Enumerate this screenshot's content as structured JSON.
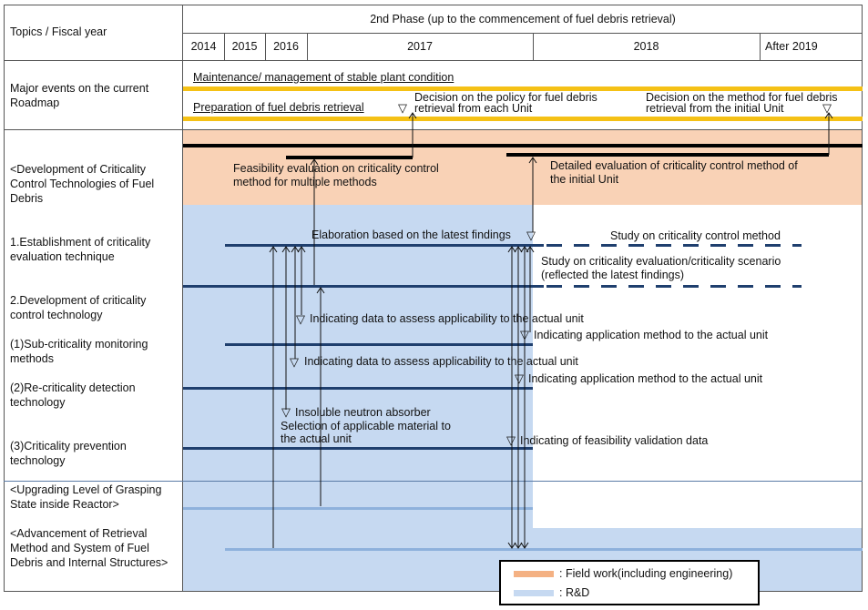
{
  "header": {
    "topics_label": "Topics / Fiscal year",
    "phase_label": "2nd Phase (up to the commencement of fuel debris retrieval)",
    "years": [
      "2014",
      "2015",
      "2016",
      "2017",
      "2018",
      "After 2019"
    ]
  },
  "rows": {
    "major_events": "Major events on the current Roadmap",
    "development": "<Development of Criticality Control Technologies of Fuel Debris",
    "item1": "1.Establishment of criticality evaluation technique",
    "item2": "2.Development of criticality control technology",
    "sub1": "(1)Sub-criticality monitoring methods",
    "sub2": "(2)Re-criticality detection technology",
    "sub3": "(3)Criticality prevention technology",
    "grasping": "<Upgrading Level of Grasping State inside Reactor>",
    "retrieval": "<Advancement of Retrieval Method and System of Fuel Debris and Internal Structures>"
  },
  "events": {
    "maintenance": "Maintenance/ management of stable plant condition",
    "preparation": "Preparation of fuel debris retrieval",
    "decision_policy_1": "Decision on the policy for fuel debris",
    "decision_policy_2": "retrieval from each Unit",
    "decision_method_1": "Decision on the method for fuel debris",
    "decision_method_2": "retrieval from the initial Unit"
  },
  "annotations": {
    "feasibility_1": "Feasibility evaluation on criticality control",
    "feasibility_2": "method for multiple methods",
    "detailed_1": "Detailed evaluation of criticality control method of",
    "detailed_2": "the initial Unit",
    "elaboration": "Elaboration based on the latest findings",
    "study_control": "Study on criticality control method",
    "study_eval_1": "Study on criticality evaluation/criticality scenario",
    "study_eval_2": "(reflected the latest findings)",
    "data_assess_1": "Indicating data to assess applicability to the actual unit",
    "app_method_1": "Indicating application method to the actual unit",
    "data_assess_2": "Indicating data to assess applicability to the actual unit",
    "app_method_2": "Indicating application method to the actual unit",
    "absorber_1": "Insoluble neutron absorber",
    "absorber_2": "Selection of applicable material to",
    "absorber_3": "the actual unit",
    "feasibility_data": "Indicating of feasibility validation data"
  },
  "legend": {
    "field_work": ": Field work(including engineering)",
    "rnd": ": R&D"
  },
  "colors": {
    "field_work": "#f8cbad",
    "rnd": "#c5d9f0",
    "event_bar": "#f5c115",
    "schedule_bar": "#1f3f6e",
    "light_bar": "#8eb1dc",
    "black_bar": "#000000"
  }
}
